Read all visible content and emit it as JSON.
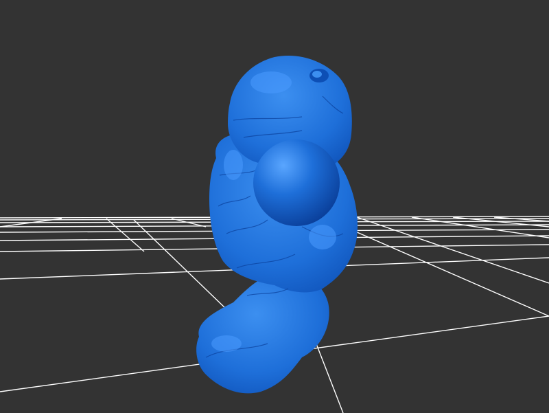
{
  "viewport": {
    "background_color": "#333333",
    "grid_color": "#ffffff",
    "model_color": "#1e6fd9",
    "model_highlight_color": "#3c8ff0",
    "model_shadow_color": "#0a3f9a"
  },
  "scene": {
    "grid": "ground-plane-grid",
    "model": "blue-sculpted-mesh",
    "sphere": "blue-sphere"
  }
}
